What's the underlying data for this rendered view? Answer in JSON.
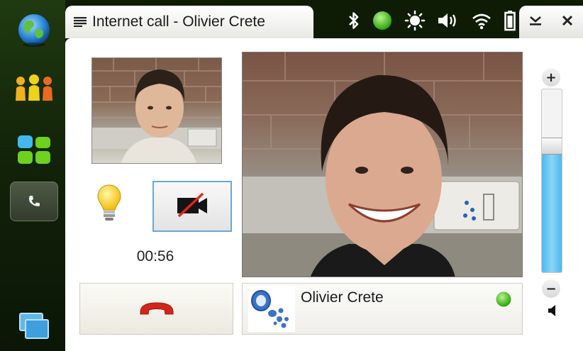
{
  "titlebar": {
    "title": "Internet call - Olivier Crete"
  },
  "status_icons": [
    "bluetooth-icon",
    "presence-online-icon",
    "brightness-icon",
    "volume-icon",
    "wifi-icon",
    "battery-icon"
  ],
  "sidebar": {
    "items": [
      "globe-icon",
      "contacts-icon",
      "app-grid-icon",
      "phone-icon",
      "task-switcher-icon"
    ],
    "active": "phone-icon"
  },
  "call": {
    "timer": "00:56",
    "camera_state": "off",
    "contact_name": "Olivier Crete",
    "presence": "online"
  },
  "volume": {
    "level": 0.69,
    "plus_label": "+",
    "minus_label": "−"
  },
  "colors": {
    "accent_blue": "#5bbef0",
    "presence_green": "#3ec21a",
    "hangup_red": "#d2261a",
    "sidebar_green": "#1b3009"
  }
}
